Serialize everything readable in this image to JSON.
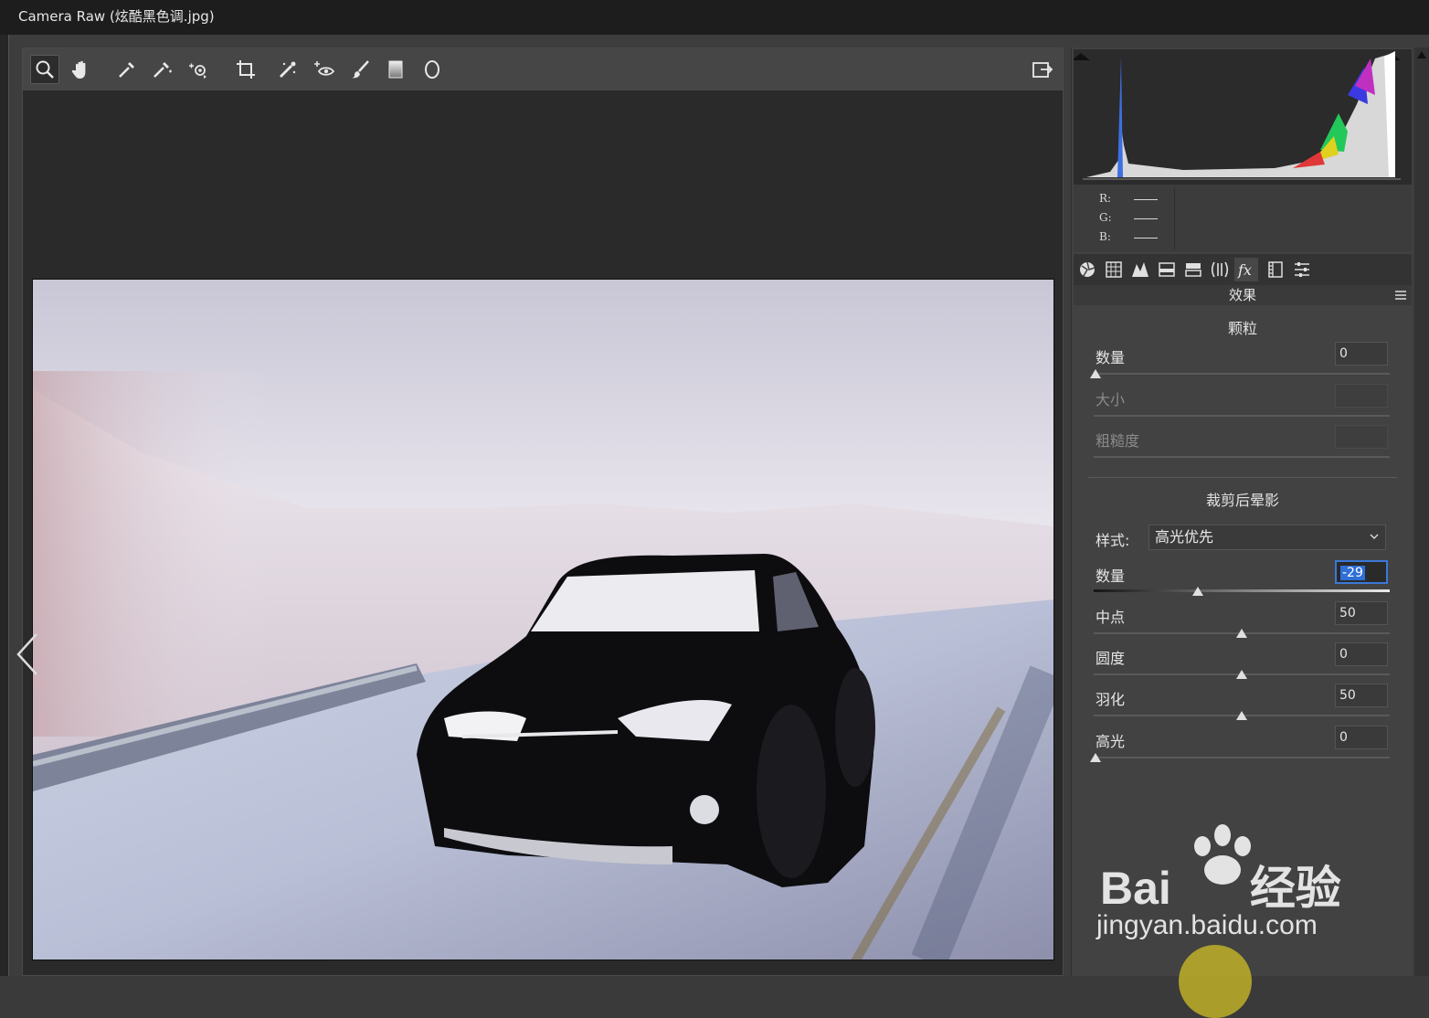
{
  "window": {
    "title": "Camera Raw (炫酷黑色调.jpg)"
  },
  "toolbar": {
    "tools": [
      "zoom-icon",
      "hand-icon",
      "white-balance-icon",
      "color-sampler-icon",
      "targeted-adjustment-icon",
      "crop-icon",
      "spot-removal-icon",
      "red-eye-icon",
      "adjustment-brush-icon",
      "graduated-filter-icon",
      "radial-filter-icon"
    ],
    "right_icon": "open-preferences-icon"
  },
  "rgb": {
    "r_label": "R:",
    "g_label": "G:",
    "b_label": "B:"
  },
  "panel_tabs": [
    "basic-icon",
    "tone-curve-icon",
    "detail-icon",
    "hsl-icon",
    "split-toning-icon",
    "lens-corrections-icon",
    "effects-icon",
    "camera-calibration-icon",
    "presets-icon"
  ],
  "panel": {
    "title": "效果"
  },
  "grain": {
    "title": "颗粒",
    "amount_label": "数量",
    "amount_value": "0",
    "amount_level": 0,
    "size_label": "大小",
    "roughness_label": "粗糙度"
  },
  "vignette": {
    "title": "裁剪后晕影",
    "style_label": "样式:",
    "style_value": "高光优先",
    "amount_label": "数量",
    "amount_value": "-29",
    "amount_level": -29,
    "midpoint_label": "中点",
    "midpoint_value": "50",
    "midpoint_level": 50,
    "roundness_label": "圆度",
    "roundness_value": "0",
    "roundness_level": 0,
    "feather_label": "羽化",
    "feather_value": "50",
    "feather_level": 50,
    "highlights_label": "高光",
    "highlights_value": "0",
    "highlights_level": 0
  },
  "watermark": {
    "line1": "Bai",
    "line1b": "经验",
    "line2": "jingyan.baidu.com"
  }
}
